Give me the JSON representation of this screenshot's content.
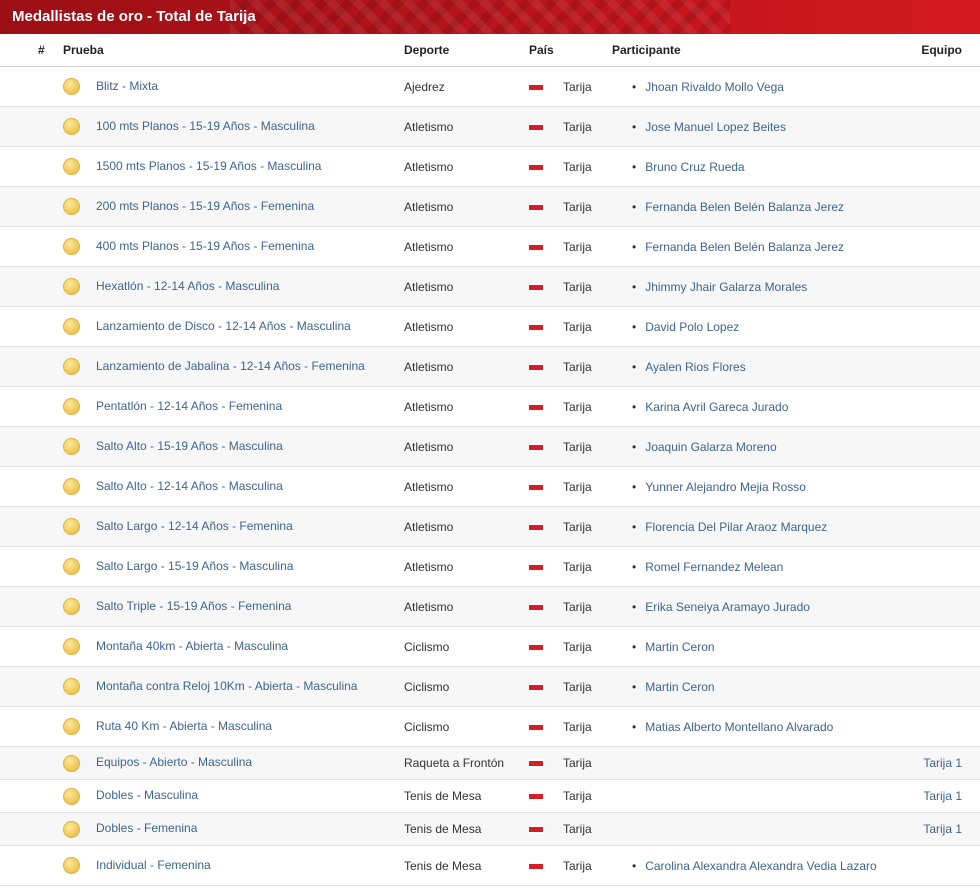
{
  "header": {
    "title": "Medallistas de oro - Total de Tarija"
  },
  "columns": {
    "hash": "#",
    "prueba": "Prueba",
    "deporte": "Deporte",
    "pais": "País",
    "participante": "Participante",
    "equipo": "Equipo"
  },
  "colors": {
    "accent_red": "#c8161e",
    "link": "#3d6591",
    "medal_gold": "#f2cf62"
  },
  "icons": {
    "medal": "gold-medal-icon",
    "flag": "flag-icon"
  },
  "rows": [
    {
      "idx": "1",
      "num": "1",
      "prueba": "Blitz - Mixta",
      "deporte": "Ajedrez",
      "pais": "Tarija",
      "participante": "Jhoan Rivaldo Mollo Vega",
      "equipo": ""
    },
    {
      "idx": "2",
      "num": "1",
      "prueba": "100 mts Planos - 15-19 Años - Masculina",
      "deporte": "Atletismo",
      "pais": "Tarija",
      "participante": "Jose Manuel Lopez Beites",
      "equipo": ""
    },
    {
      "idx": "3",
      "num": "1",
      "prueba": "1500 mts Planos - 15-19 Años - Masculina",
      "deporte": "Atletismo",
      "pais": "Tarija",
      "participante": "Bruno Cruz Rueda",
      "equipo": ""
    },
    {
      "idx": "4",
      "num": "1",
      "prueba": "200 mts Planos - 15-19 Años - Femenina",
      "deporte": "Atletismo",
      "pais": "Tarija",
      "participante": "Fernanda Belen Belén Balanza Jerez",
      "equipo": ""
    },
    {
      "idx": "5",
      "num": "1",
      "prueba": "400 mts Planos - 15-19 Años - Femenina",
      "deporte": "Atletismo",
      "pais": "Tarija",
      "participante": "Fernanda Belen Belén Balanza Jerez",
      "equipo": ""
    },
    {
      "idx": "6",
      "num": "1",
      "prueba": "Hexatlón - 12-14 Años - Masculina",
      "deporte": "Atletismo",
      "pais": "Tarija",
      "participante": "Jhimmy Jhair Galarza Morales",
      "equipo": ""
    },
    {
      "idx": "7",
      "num": "1",
      "prueba": "Lanzamiento de Disco - 12-14 Años - Masculina",
      "deporte": "Atletismo",
      "pais": "Tarija",
      "participante": "David Polo Lopez",
      "equipo": ""
    },
    {
      "idx": "8",
      "num": "1",
      "prueba": "Lanzamiento de Jabalina - 12-14 Años - Femenina",
      "deporte": "Atletismo",
      "pais": "Tarija",
      "participante": "Ayalen Rios Flores",
      "equipo": ""
    },
    {
      "idx": "9",
      "num": "1",
      "prueba": "Pentatlón - 12-14 Años - Femenina",
      "deporte": "Atletismo",
      "pais": "Tarija",
      "participante": "Karina Avril Gareca Jurado",
      "equipo": ""
    },
    {
      "idx": "10",
      "num": "1",
      "prueba": "Salto Alto - 15-19 Años - Masculina",
      "deporte": "Atletismo",
      "pais": "Tarija",
      "participante": "Joaquin Galarza Moreno",
      "equipo": ""
    },
    {
      "idx": "11",
      "num": "1",
      "prueba": "Salto Alto - 12-14 Años - Masculina",
      "deporte": "Atletismo",
      "pais": "Tarija",
      "participante": "Yunner Alejandro Mejia Rosso",
      "equipo": ""
    },
    {
      "idx": "12",
      "num": "1",
      "prueba": "Salto Largo - 12-14 Años - Femenina",
      "deporte": "Atletismo",
      "pais": "Tarija",
      "participante": "Florencia Del Pilar Araoz Marquez",
      "equipo": ""
    },
    {
      "idx": "13",
      "num": "1",
      "prueba": "Salto Largo - 15-19 Años - Masculina",
      "deporte": "Atletismo",
      "pais": "Tarija",
      "participante": "Romel Fernandez Melean",
      "equipo": ""
    },
    {
      "idx": "14",
      "num": "1",
      "prueba": "Salto Triple - 15-19 Años - Femenina",
      "deporte": "Atletismo",
      "pais": "Tarija",
      "participante": "Erika Seneiya Aramayo Jurado",
      "equipo": ""
    },
    {
      "idx": "15",
      "num": "1",
      "prueba": "Montaña 40km - Abierta - Masculina",
      "deporte": "Ciclismo",
      "pais": "Tarija",
      "participante": "Martin Ceron",
      "equipo": ""
    },
    {
      "idx": "16",
      "num": "1",
      "prueba": "Montaña contra Reloj 10Km - Abierta - Masculina",
      "deporte": "Ciclismo",
      "pais": "Tarija",
      "participante": "Martin Ceron",
      "equipo": ""
    },
    {
      "idx": "17",
      "num": "1",
      "prueba": "Ruta 40 Km - Abierta - Masculina",
      "deporte": "Ciclismo",
      "pais": "Tarija",
      "participante": "Matias Alberto Montellano Alvarado",
      "equipo": ""
    },
    {
      "idx": "18",
      "num": "1",
      "prueba": "Equipos - Abierto - Masculina",
      "deporte": "Raqueta a Frontón",
      "pais": "Tarija",
      "participante": "",
      "equipo": "Tarija 1"
    },
    {
      "idx": "19",
      "num": "1",
      "prueba": "Dobles - Masculina",
      "deporte": "Tenis de Mesa",
      "pais": "Tarija",
      "participante": "",
      "equipo": "Tarija 1"
    },
    {
      "idx": "20",
      "num": "1",
      "prueba": "Dobles - Femenina",
      "deporte": "Tenis de Mesa",
      "pais": "Tarija",
      "participante": "",
      "equipo": "Tarija 1"
    },
    {
      "idx": "21",
      "num": "1",
      "prueba": "Individual - Femenina",
      "deporte": "Tenis de Mesa",
      "pais": "Tarija",
      "participante": "Carolina Alexandra Alexandra Vedia Lazaro",
      "equipo": ""
    }
  ]
}
